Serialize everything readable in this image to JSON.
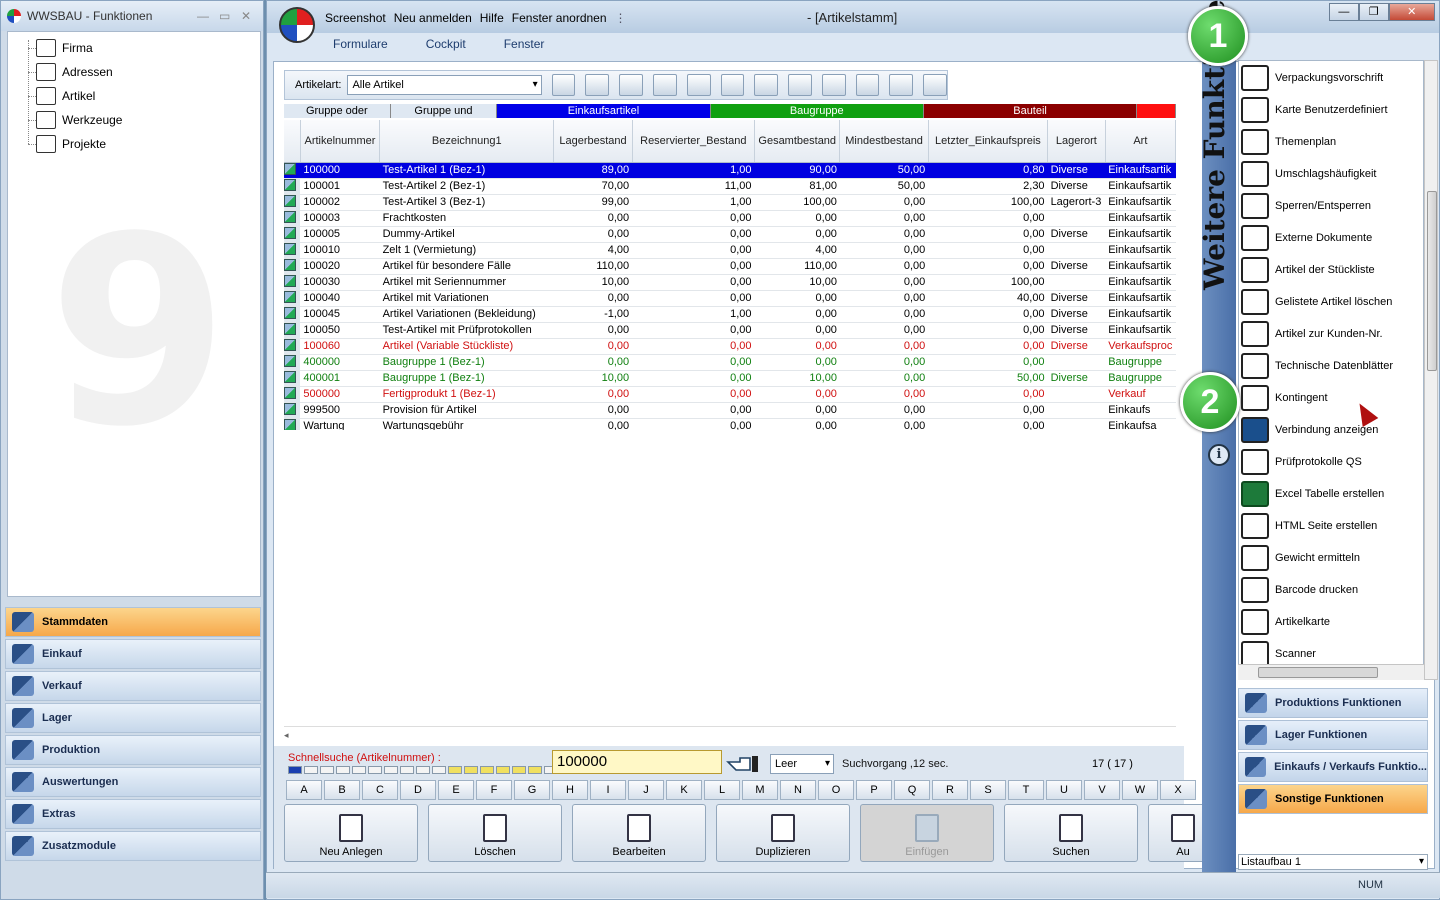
{
  "left_window": {
    "title": "WWSBAU - Funktionen",
    "tree": [
      {
        "label": "Firma",
        "icon": "factory-icon"
      },
      {
        "label": "Adressen",
        "icon": "address-card-icon"
      },
      {
        "label": "Artikel",
        "icon": "box-icon"
      },
      {
        "label": "Werkzeuge",
        "icon": "tools-icon"
      },
      {
        "label": "Projekte",
        "icon": "project-icon"
      }
    ],
    "nav": [
      {
        "label": "Stammdaten",
        "icon": "master-data-icon",
        "active": true
      },
      {
        "label": "Einkauf",
        "icon": "cart-icon"
      },
      {
        "label": "Verkauf",
        "icon": "cash-register-icon"
      },
      {
        "label": "Lager",
        "icon": "warehouse-icon"
      },
      {
        "label": "Produktion",
        "icon": "production-icon"
      },
      {
        "label": "Auswertungen",
        "icon": "analytics-icon"
      },
      {
        "label": "Extras",
        "icon": "extras-icon"
      },
      {
        "label": "Zusatzmodule",
        "icon": "modules-icon"
      }
    ]
  },
  "main_window": {
    "menu": [
      "Screenshot",
      "Neu anmelden",
      "Hilfe",
      "Fenster anordnen"
    ],
    "title": "- [Artikelstamm]",
    "ribbon_tabs": [
      "Formulare",
      "Cockpit",
      "Fenster"
    ],
    "toolbar": {
      "label": "Artikelart:",
      "value": "Alle Artikel"
    },
    "color_bar": [
      {
        "label": "Gruppe oder",
        "color": "#dfe8f2",
        "text_color": "#000"
      },
      {
        "label": "Gruppe und",
        "color": "#dfe8f2",
        "text_color": "#000"
      },
      {
        "label": "Einkaufsartikel",
        "color": "#0000e8",
        "text_color": "#fff"
      },
      {
        "label": "Baugruppe",
        "color": "#10a010",
        "text_color": "#fff"
      },
      {
        "label": "Bauteil",
        "color": "#8b0000",
        "text_color": "#fff"
      },
      {
        "label": "",
        "color": "#ff1010",
        "text_color": "#fff"
      }
    ],
    "columns": [
      "Artikelnummer",
      "Bezeichnung1",
      "Lagerbestand",
      "Reservierter_Bestand",
      "Gesamtbestand",
      "Mindestbestand",
      "Letzter_Einkaufspreis",
      "Lagerort",
      "Art"
    ],
    "rows": [
      {
        "nr": "100000",
        "bez": "Test-Artikel 1  (Bez-1)",
        "lager": "89,00",
        "res": "1,00",
        "ges": "90,00",
        "min": "50,00",
        "preis": "0,80",
        "ort": "Diverse",
        "art": "Einkaufsartik",
        "style": "sel"
      },
      {
        "nr": "100001",
        "bez": "Test-Artikel 2  (Bez-1)",
        "lager": "70,00",
        "res": "11,00",
        "ges": "81,00",
        "min": "50,00",
        "preis": "2,30",
        "ort": "Diverse",
        "art": "Einkaufsartik",
        "style": ""
      },
      {
        "nr": "100002",
        "bez": "Test-Artikel 3  (Bez-1)",
        "lager": "99,00",
        "res": "1,00",
        "ges": "100,00",
        "min": "0,00",
        "preis": "100,00",
        "ort": "Lagerort-3",
        "art": "Einkaufsartik",
        "style": ""
      },
      {
        "nr": "100003",
        "bez": "Frachtkosten",
        "lager": "0,00",
        "res": "0,00",
        "ges": "0,00",
        "min": "0,00",
        "preis": "0,00",
        "ort": "",
        "art": "Einkaufsartik",
        "style": ""
      },
      {
        "nr": "100005",
        "bez": "Dummy-Artikel",
        "lager": "0,00",
        "res": "0,00",
        "ges": "0,00",
        "min": "0,00",
        "preis": "0,00",
        "ort": "Diverse",
        "art": "Einkaufsartik",
        "style": ""
      },
      {
        "nr": "100010",
        "bez": "Zelt 1 (Vermietung)",
        "lager": "4,00",
        "res": "0,00",
        "ges": "4,00",
        "min": "0,00",
        "preis": "0,00",
        "ort": "",
        "art": "Einkaufsartik",
        "style": ""
      },
      {
        "nr": "100020",
        "bez": "Artikel für besondere Fälle",
        "lager": "110,00",
        "res": "0,00",
        "ges": "110,00",
        "min": "0,00",
        "preis": "0,00",
        "ort": "Diverse",
        "art": "Einkaufsartik",
        "style": ""
      },
      {
        "nr": "100030",
        "bez": "Artikel mit Seriennummer",
        "lager": "10,00",
        "res": "0,00",
        "ges": "10,00",
        "min": "0,00",
        "preis": "100,00",
        "ort": "",
        "art": "Einkaufsartik",
        "style": ""
      },
      {
        "nr": "100040",
        "bez": "Artikel mit Variationen",
        "lager": "0,00",
        "res": "0,00",
        "ges": "0,00",
        "min": "0,00",
        "preis": "40,00",
        "ort": "Diverse",
        "art": "Einkaufsartik",
        "style": ""
      },
      {
        "nr": "100045",
        "bez": "Artikel Variationen (Bekleidung)",
        "lager": "-1,00",
        "res": "1,00",
        "ges": "0,00",
        "min": "0,00",
        "preis": "0,00",
        "ort": "Diverse",
        "art": "Einkaufsartik",
        "style": ""
      },
      {
        "nr": "100050",
        "bez": "Test-Artikel mit Prüfprotokollen",
        "lager": "0,00",
        "res": "0,00",
        "ges": "0,00",
        "min": "0,00",
        "preis": "0,00",
        "ort": "Diverse",
        "art": "Einkaufsartik",
        "style": ""
      },
      {
        "nr": "100060",
        "bez": "Artikel (Variable Stückliste)",
        "lager": "0,00",
        "res": "0,00",
        "ges": "0,00",
        "min": "0,00",
        "preis": "0,00",
        "ort": "Diverse",
        "art": "Verkaufsproc",
        "style": "red"
      },
      {
        "nr": "400000",
        "bez": "Baugruppe 1  (Bez-1)",
        "lager": "0,00",
        "res": "0,00",
        "ges": "0,00",
        "min": "0,00",
        "preis": "0,00",
        "ort": "",
        "art": "Baugruppe",
        "style": "green"
      },
      {
        "nr": "400001",
        "bez": "Baugruppe 1  (Bez-1)",
        "lager": "10,00",
        "res": "0,00",
        "ges": "10,00",
        "min": "0,00",
        "preis": "50,00",
        "ort": "Diverse",
        "art": "Baugruppe",
        "style": "green"
      },
      {
        "nr": "500000",
        "bez": "Fertigprodukt 1  (Bez-1)",
        "lager": "0,00",
        "res": "0,00",
        "ges": "0,00",
        "min": "0,00",
        "preis": "0,00",
        "ort": "",
        "art": "Verkauf",
        "style": "red"
      },
      {
        "nr": "999500",
        "bez": "Provision für Artikel",
        "lager": "0,00",
        "res": "0,00",
        "ges": "0,00",
        "min": "0,00",
        "preis": "0,00",
        "ort": "",
        "art": "Einkaufs",
        "style": ""
      },
      {
        "nr": "Wartung",
        "bez": "Wartungsgebühr",
        "lager": "0,00",
        "res": "0,00",
        "ges": "0,00",
        "min": "0,00",
        "preis": "0,00",
        "ort": "",
        "art": "Einkaufsa",
        "style": ""
      }
    ],
    "quicksearch": {
      "label": "Schnellsuche (Artikelnummer) :",
      "value": "100000",
      "mode": "Leer",
      "status": "Suchvorgang ,12 sec.",
      "count": "17  ( 17 )"
    },
    "letters": [
      "A",
      "B",
      "C",
      "D",
      "E",
      "F",
      "G",
      "H",
      "I",
      "J",
      "K",
      "L",
      "M",
      "N",
      "O",
      "P",
      "Q",
      "R",
      "S",
      "T",
      "U",
      "V",
      "W",
      "X"
    ],
    "actions": [
      {
        "label": "Neu Anlegen",
        "icon": "new-document-icon",
        "enabled": true
      },
      {
        "label": "Löschen",
        "icon": "trash-icon",
        "enabled": true
      },
      {
        "label": "Bearbeiten",
        "icon": "edit-icon",
        "enabled": true
      },
      {
        "label": "Duplizieren",
        "icon": "duplicate-icon",
        "enabled": true
      },
      {
        "label": "Einfügen",
        "icon": "paste-icon",
        "enabled": false
      },
      {
        "label": "Suchen",
        "icon": "binoculars-icon",
        "enabled": true
      },
      {
        "label": "Au",
        "icon": "export-icon",
        "enabled": true
      }
    ]
  },
  "right_panel": {
    "vertical_title": "Weitere Funktionen",
    "functions": [
      {
        "label": "Verpackungsvorschrift",
        "icon": "packaging-icon"
      },
      {
        "label": "Karte Benutzerdefiniert",
        "icon": "custom-card-icon"
      },
      {
        "label": "Themenplan",
        "icon": "presentation-icon"
      },
      {
        "label": "Umschlagshäufigkeit",
        "icon": "turnover-icon"
      },
      {
        "label": "Sperren/Entsperren",
        "icon": "lock-icon"
      },
      {
        "label": "Externe Dokumente",
        "icon": "external-document-icon"
      },
      {
        "label": "Artikel der Stückliste",
        "icon": "bom-icon"
      },
      {
        "label": "Gelistete Artikel löschen",
        "icon": "delete-listed-icon"
      },
      {
        "label": "Artikel zur Kunden-Nr.",
        "icon": "customer-article-icon"
      },
      {
        "label": "Technische Datenblätter",
        "icon": "gears-icon"
      },
      {
        "label": "Kontingent",
        "icon": "quota-icon"
      },
      {
        "label": "Verbindung anzeigen",
        "icon": "link-icon"
      },
      {
        "label": "Prüfprotokolle QS",
        "icon": "checklist-icon"
      },
      {
        "label": "Excel Tabelle erstellen",
        "icon": "excel-icon"
      },
      {
        "label": "HTML Seite erstellen",
        "icon": "globe-icon"
      },
      {
        "label": "Gewicht ermitteln",
        "icon": "weight-icon"
      },
      {
        "label": "Barcode drucken",
        "icon": "barcode-icon"
      },
      {
        "label": "Artikelkarte",
        "icon": "article-card-icon"
      },
      {
        "label": "Scanner",
        "icon": "scanner-icon"
      }
    ],
    "nav": [
      {
        "label": "Produktions Funktionen",
        "icon": "production-icon"
      },
      {
        "label": "Lager Funktionen",
        "icon": "warehouse-icon"
      },
      {
        "label": "Einkaufs / Verkaufs Funktio...",
        "icon": "cart-icon"
      },
      {
        "label": "Sonstige Funktionen",
        "icon": "misc-icon",
        "active": true
      }
    ],
    "list_layout": "Listaufbau 1"
  },
  "badges": [
    "1",
    "2"
  ],
  "status_bar": {
    "num": "NUM"
  }
}
